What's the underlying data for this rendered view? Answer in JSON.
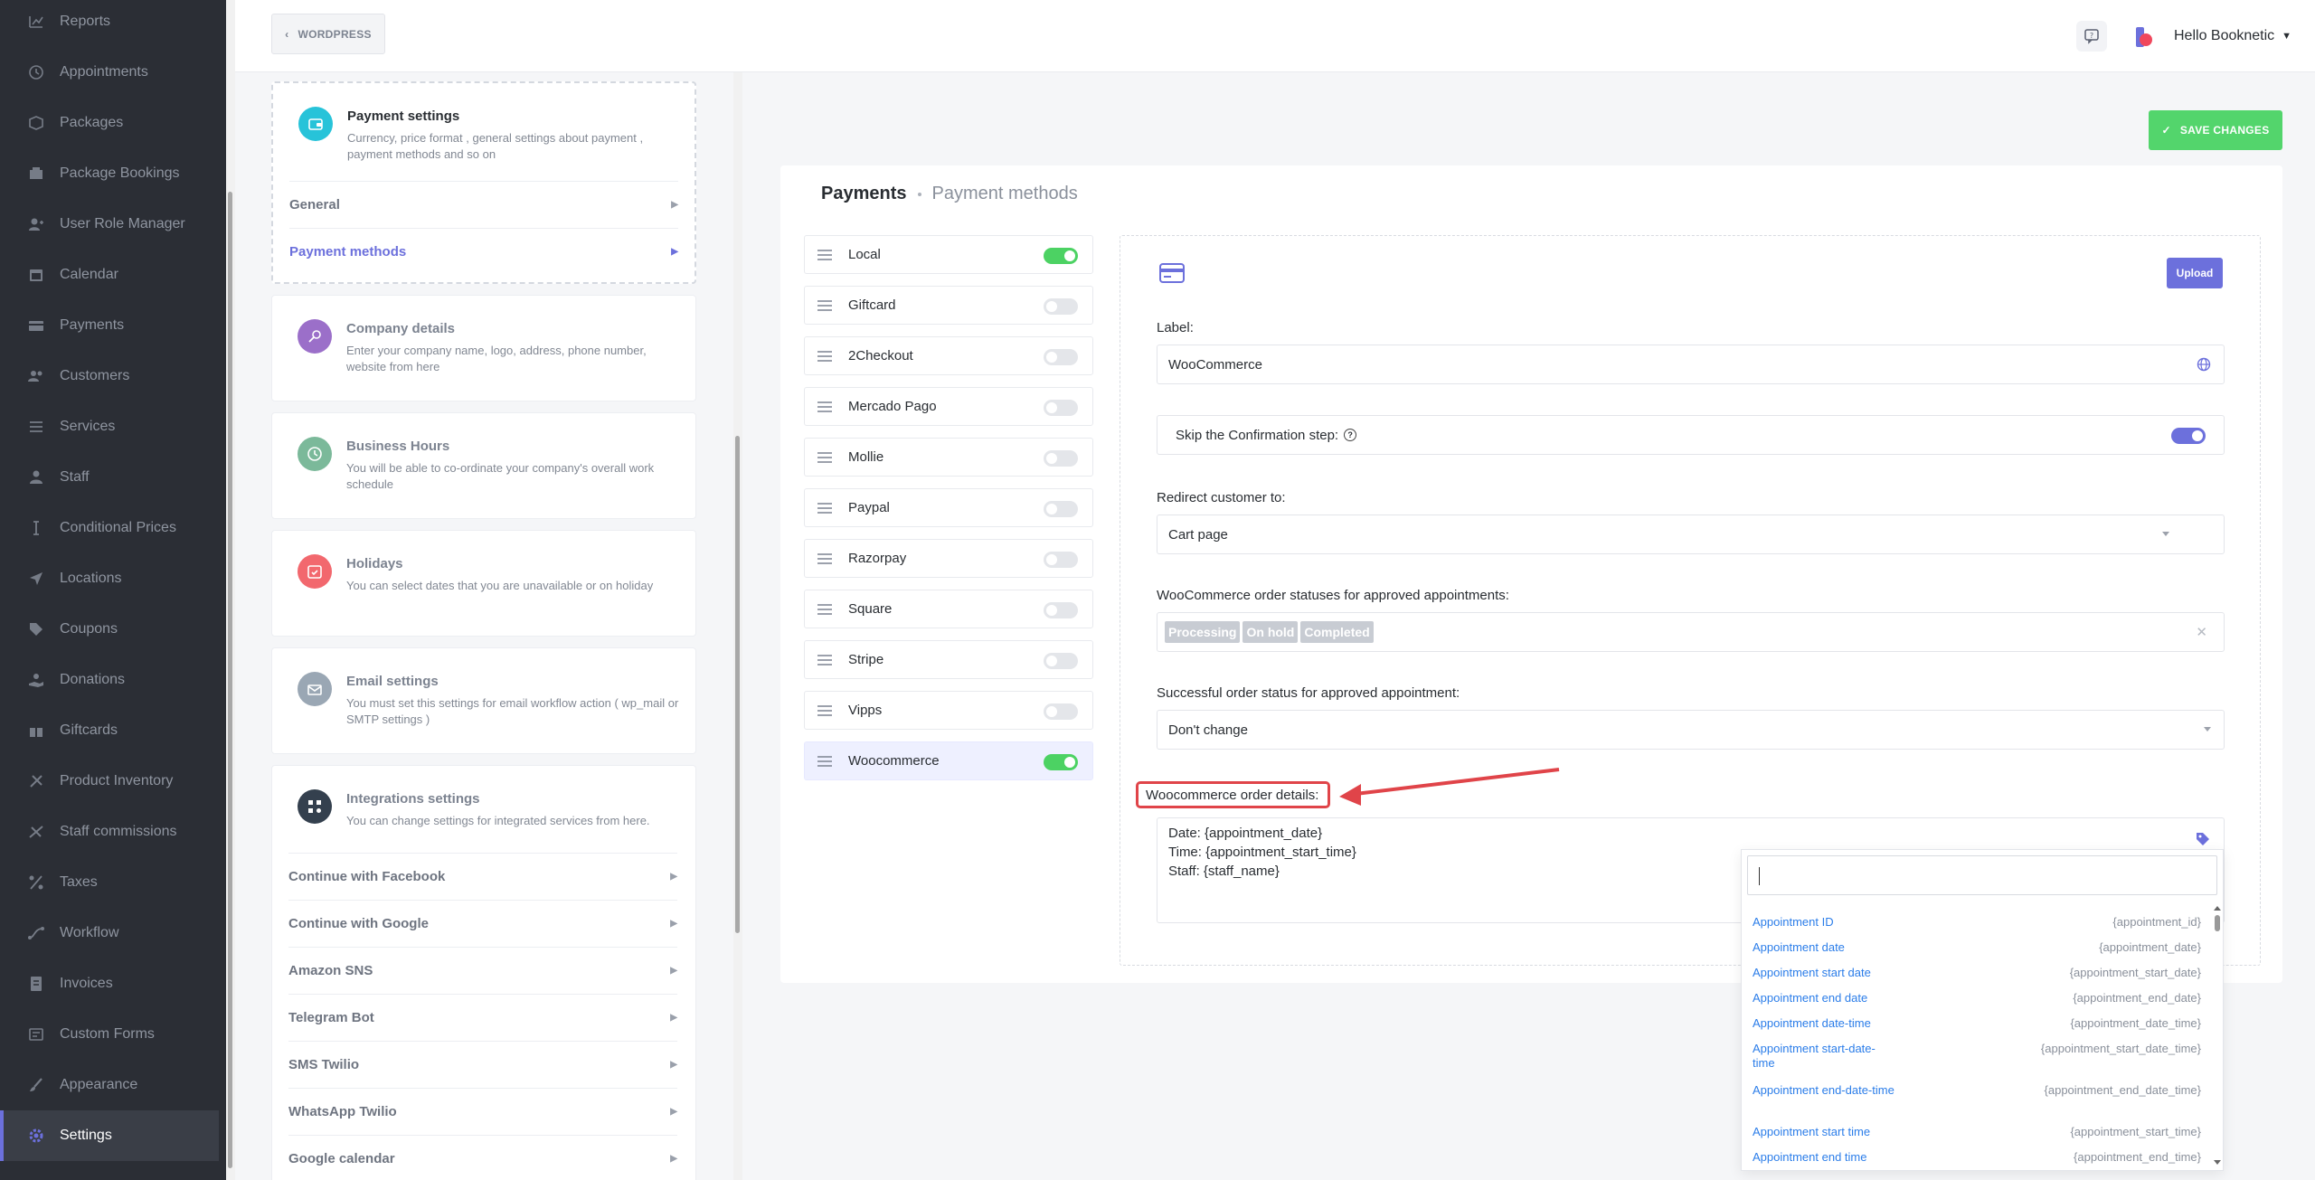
{
  "sidebar": {
    "items": [
      {
        "label": "Reports",
        "icon": "chart-icon"
      },
      {
        "label": "Appointments",
        "icon": "clock-icon"
      },
      {
        "label": "Packages",
        "icon": "box-icon"
      },
      {
        "label": "Package Bookings",
        "icon": "box-list-icon"
      },
      {
        "label": "User Role Manager",
        "icon": "user-role-icon"
      },
      {
        "label": "Calendar",
        "icon": "calendar-icon"
      },
      {
        "label": "Payments",
        "icon": "credit-card-icon"
      },
      {
        "label": "Customers",
        "icon": "users-icon"
      },
      {
        "label": "Services",
        "icon": "list-icon"
      },
      {
        "label": "Staff",
        "icon": "user-icon"
      },
      {
        "label": "Conditional Prices",
        "icon": "text-cursor-icon"
      },
      {
        "label": "Locations",
        "icon": "location-icon"
      },
      {
        "label": "Coupons",
        "icon": "tag-icon"
      },
      {
        "label": "Donations",
        "icon": "donation-icon"
      },
      {
        "label": "Giftcards",
        "icon": "gift-icon"
      },
      {
        "label": "Product Inventory",
        "icon": "inventory-icon"
      },
      {
        "label": "Staff commissions",
        "icon": "commission-icon"
      },
      {
        "label": "Taxes",
        "icon": "percent-icon"
      },
      {
        "label": "Workflow",
        "icon": "workflow-icon"
      },
      {
        "label": "Invoices",
        "icon": "invoice-icon"
      },
      {
        "label": "Custom Forms",
        "icon": "forms-icon"
      },
      {
        "label": "Appearance",
        "icon": "brush-icon"
      },
      {
        "label": "Settings",
        "icon": "gear-icon"
      }
    ],
    "active_index": 22
  },
  "header": {
    "back_label": "WORDPRESS",
    "user_label": "Hello Booknetic"
  },
  "settings_cards": {
    "payment": {
      "title": "Payment settings",
      "desc": "Currency, price format , general settings about payment , payment methods and so on",
      "subs": [
        "General",
        "Payment methods"
      ]
    },
    "company": {
      "title": "Company details",
      "desc": "Enter your company name, logo, address, phone number, website from here"
    },
    "hours": {
      "title": "Business Hours",
      "desc": "You will be able to co-ordinate your company's overall work schedule"
    },
    "holidays": {
      "title": "Holidays",
      "desc": "You can select dates that you are unavailable or on holiday"
    },
    "email": {
      "title": "Email settings",
      "desc": "You must set this settings for email workflow action ( wp_mail or SMTP settings )"
    },
    "integrations": {
      "title": "Integrations settings",
      "desc": "You can change settings for integrated services from here.",
      "subs": [
        "Continue with Facebook",
        "Continue with Google",
        "Amazon SNS",
        "Telegram Bot",
        "SMS Twilio",
        "WhatsApp Twilio",
        "Google calendar"
      ]
    }
  },
  "toolbar": {
    "save_label": "SAVE CHANGES"
  },
  "breadcrumb": {
    "root": "Payments",
    "current": "Payment methods"
  },
  "payment_methods": [
    {
      "name": "Local",
      "enabled": true
    },
    {
      "name": "Giftcard",
      "enabled": false
    },
    {
      "name": "2Checkout",
      "enabled": false
    },
    {
      "name": "Mercado Pago",
      "enabled": false
    },
    {
      "name": "Mollie",
      "enabled": false
    },
    {
      "name": "Paypal",
      "enabled": false
    },
    {
      "name": "Razorpay",
      "enabled": false
    },
    {
      "name": "Square",
      "enabled": false
    },
    {
      "name": "Stripe",
      "enabled": false
    },
    {
      "name": "Vipps",
      "enabled": false
    },
    {
      "name": "Woocommerce",
      "enabled": true
    }
  ],
  "form": {
    "upload_label": "Upload",
    "label_title": "Label:",
    "label_value": "WooCommerce",
    "skip_label": "Skip the Confirmation step:",
    "skip_enabled": true,
    "redirect_title": "Redirect customer to:",
    "redirect_value": "Cart page",
    "statuses_title": "WooCommerce order statuses for approved appointments:",
    "statuses": [
      "Processing",
      "On hold",
      "Completed"
    ],
    "success_title": "Successful order status for approved appointment:",
    "success_value": "Don't change",
    "details_title": "Woocommerce order details:",
    "details_lines": [
      "Date: {appointment_date}",
      "Time: {appointment_start_time}",
      "Staff: {staff_name}"
    ]
  },
  "dropdown": {
    "search_value": "",
    "items": [
      {
        "name": "Appointment ID",
        "key": "{appointment_id}"
      },
      {
        "name": "Appointment date",
        "key": "{appointment_date}"
      },
      {
        "name": "Appointment start date",
        "key": "{appointment_start_date}"
      },
      {
        "name": "Appointment end date",
        "key": "{appointment_end_date}"
      },
      {
        "name": "Appointment date-time",
        "key": "{appointment_date_time}"
      },
      {
        "name": "Appointment start-date-time",
        "key": "{appointment_start_date_time}"
      },
      {
        "name": "Appointment end-date-time",
        "key": "{appointment_end_date_time}"
      },
      {
        "name": "Appointment start time",
        "key": "{appointment_start_time}"
      },
      {
        "name": "Appointment end time",
        "key": "{appointment_end_time}"
      }
    ]
  },
  "colors": {
    "accent": "#6c70dc",
    "success": "#53d56c",
    "highlight": "#e04449",
    "link": "#2b7de9"
  }
}
